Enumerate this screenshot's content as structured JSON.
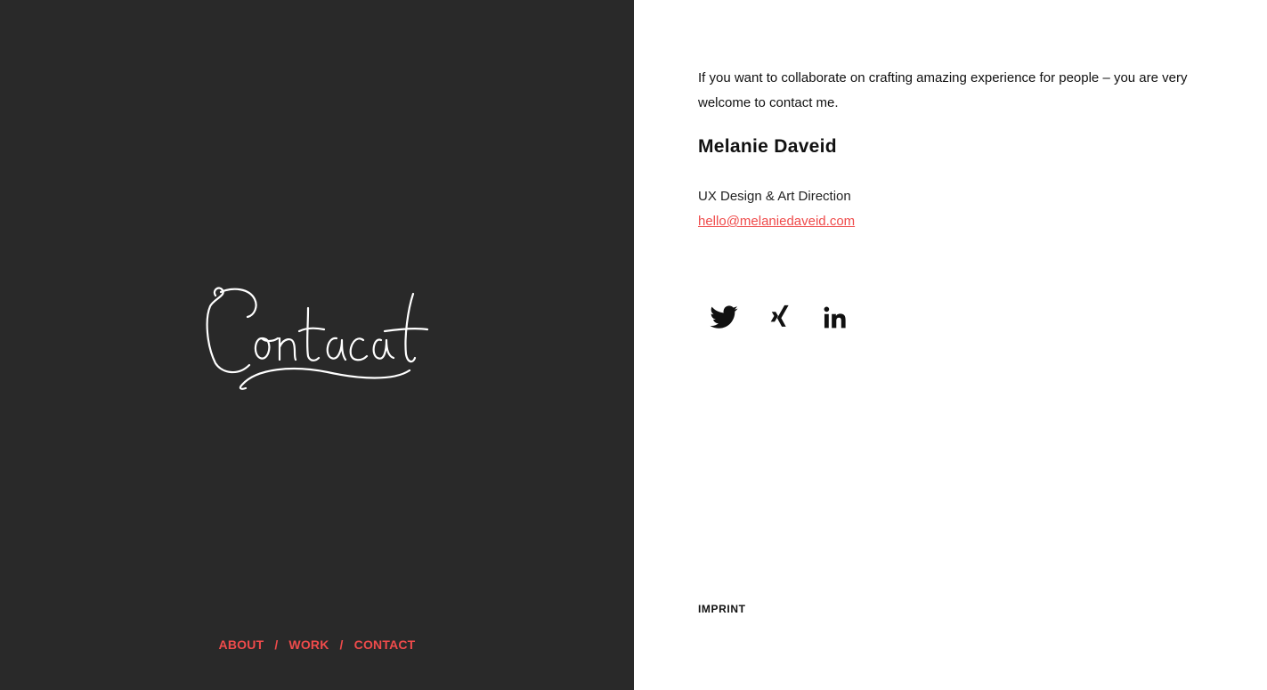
{
  "hero": {
    "script_title": "Contact",
    "background_color": "#292929",
    "script_color": "#ffffff"
  },
  "nav": {
    "items": [
      {
        "label": "ABOUT"
      },
      {
        "label": "WORK"
      },
      {
        "label": "CONTACT"
      }
    ],
    "separator": "/",
    "accent_color": "#ef4b4b"
  },
  "contact": {
    "intro": "If you want to collaborate on crafting amazing experience for people – you are very welcome to contact me.",
    "name": "Melanie Daveid",
    "role": "UX Design & Art Direction",
    "email": "hello@melaniedaveid.com"
  },
  "socials": [
    {
      "icon": "twitter-icon"
    },
    {
      "icon": "xing-icon"
    },
    {
      "icon": "linkedin-icon"
    }
  ],
  "footer": {
    "imprint_label": "IMPRINT"
  }
}
